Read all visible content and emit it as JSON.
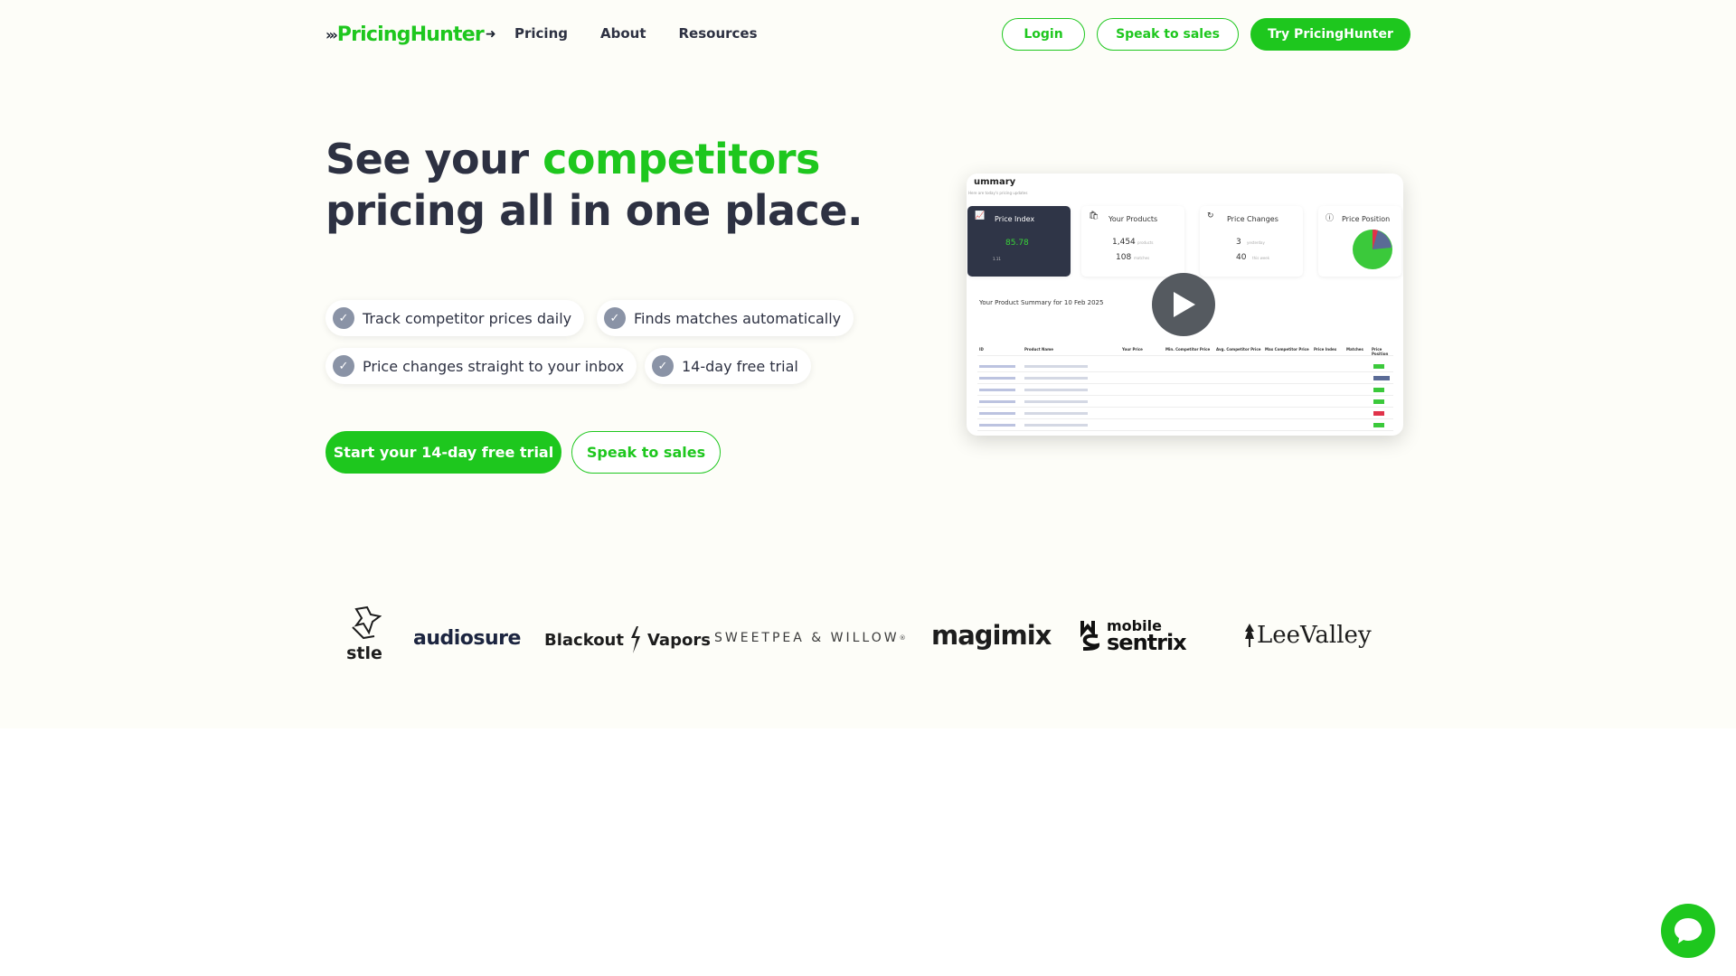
{
  "nav": {
    "logo_text": "PricingHunter",
    "links": [
      "Pricing",
      "About",
      "Resources"
    ],
    "login": "Login",
    "speak_to_sales": "Speak to sales",
    "try": "Try PricingHunter"
  },
  "hero": {
    "headline_1": "See your ",
    "headline_accent": "competitors",
    "headline_2": "pricing all in one place.",
    "features": [
      "Track competitor prices daily",
      "Finds matches automatically",
      "Price changes straight to your inbox",
      "14-day free trial"
    ],
    "cta_primary": "Start your 14-day free trial",
    "cta_secondary": "Speak to sales"
  },
  "video": {
    "title": "ummary",
    "subtitle": "Here are today's pricing updates",
    "cards": [
      {
        "title": "Price Index",
        "value": "85.78",
        "sub": "1.11"
      },
      {
        "title": "Your Products",
        "value": "1,454",
        "unit": "products",
        "value2": "108",
        "unit2": "matches"
      },
      {
        "title": "Price Changes",
        "value": "3",
        "unit": "yesterday",
        "value2": "40",
        "unit2": "this week"
      },
      {
        "title": "Price Position"
      }
    ],
    "summary_title": "Your Product Summary for 10 Feb 2025",
    "table_headers": [
      "ID",
      "Product Name",
      "Your Price",
      "Min. Competitor Price",
      "Avg. Competitor Price",
      "Max Competitor Price",
      "Price Index",
      "Matches",
      "Price Position"
    ]
  },
  "brands": [
    "stle",
    "audiosure",
    "Blackout",
    "Vapors",
    "SWEETPEA & WILLOW",
    "magimix",
    "mobile",
    "sentrix",
    "LeeValley"
  ],
  "colors": {
    "accent": "#1ec71e",
    "text": "#2d3142",
    "check": "#8a93a6"
  }
}
